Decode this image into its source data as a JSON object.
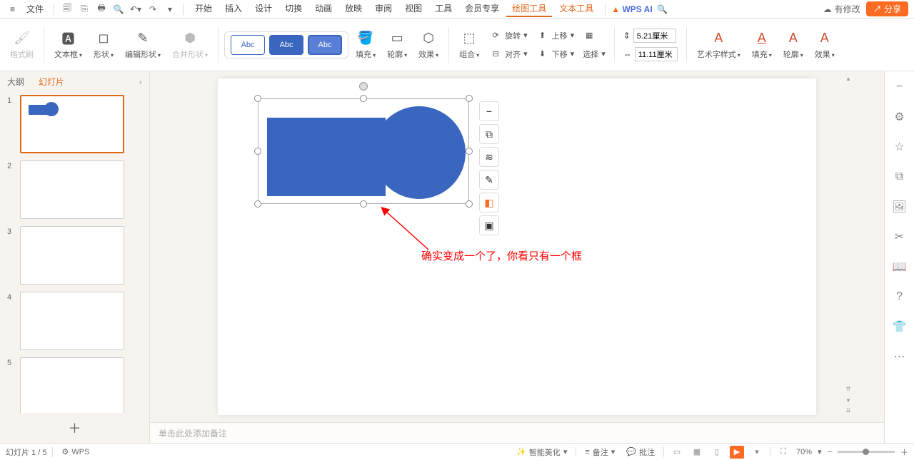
{
  "menu": {
    "file": "文件"
  },
  "tabs": {
    "start": "开始",
    "insert": "插入",
    "design": "设计",
    "transition": "切换",
    "animation": "动画",
    "slideshow": "放映",
    "review": "审阅",
    "view": "视图",
    "tools": "工具",
    "member": "会员专享",
    "drawing": "绘图工具",
    "text": "文本工具"
  },
  "topright": {
    "ai": "WPS AI",
    "modified": "有修改",
    "share": "分享"
  },
  "ribbon": {
    "format_painter": "格式刷",
    "textbox": "文本框",
    "shape": "形状",
    "edit_shape": "编辑形状",
    "merge_shape": "合并形状",
    "abc": "Abc",
    "fill": "填充",
    "outline": "轮廓",
    "effect": "效果",
    "combine": "组合",
    "rotate": "旋转",
    "align": "对齐",
    "up": "上移",
    "down": "下移",
    "select": "选择",
    "height_val": "5.21厘米",
    "width_val": "11.11厘米",
    "art_style": "艺术字样式",
    "fill2": "填充",
    "outline2": "轮廓",
    "effect2": "效果"
  },
  "panel": {
    "outline": "大纲",
    "slides": "幻灯片"
  },
  "slides": [
    "1",
    "2",
    "3",
    "4",
    "5"
  ],
  "annotation": "确实变成一个了，你看只有一个框",
  "notes_placeholder": "单击此处添加备注",
  "status": {
    "slide_counter": "幻灯片 1 / 5",
    "author": "WPS",
    "beautify": "智能美化",
    "notes": "备注",
    "comments": "批注",
    "zoom": "70%"
  }
}
